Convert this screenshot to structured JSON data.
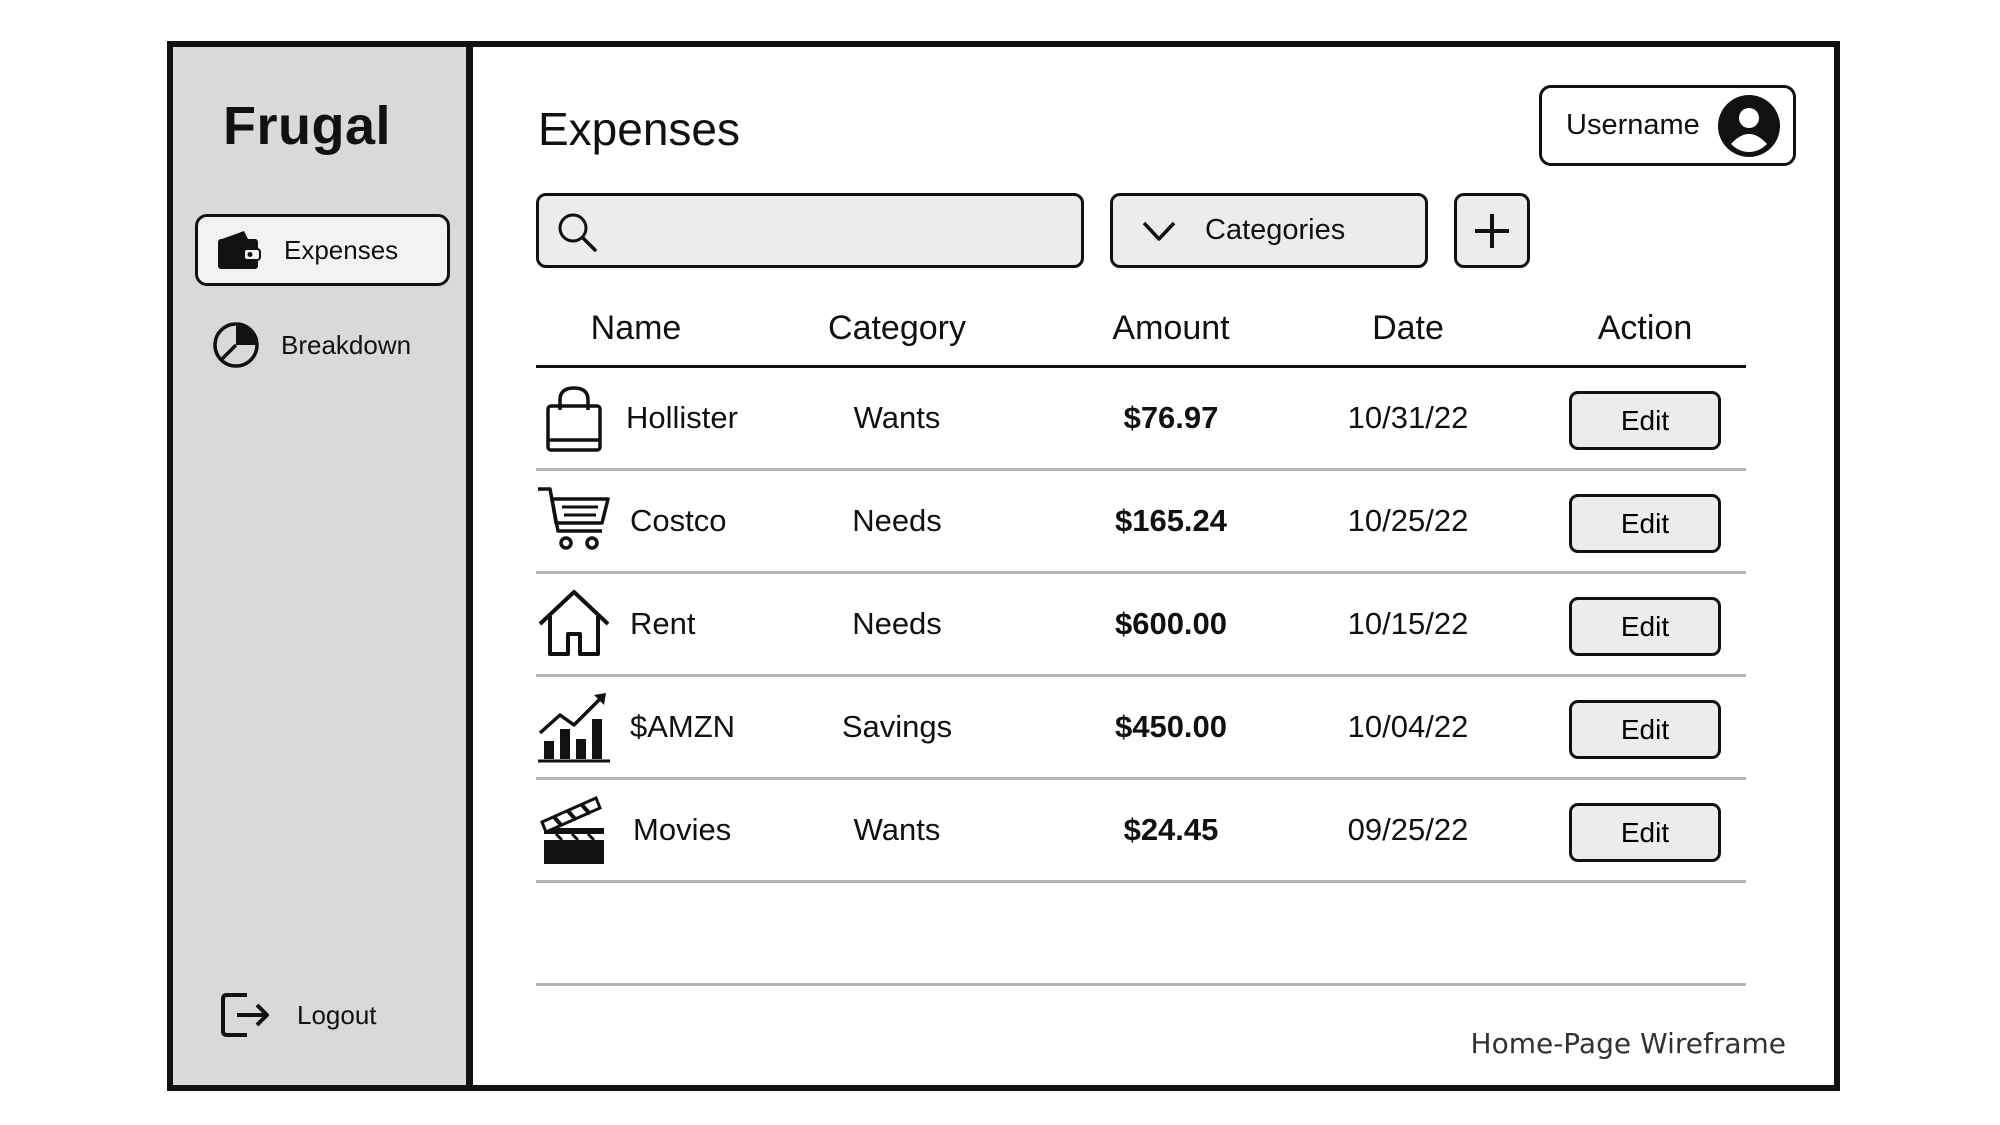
{
  "app": {
    "brand": "Frugal"
  },
  "sidebar": {
    "items": [
      {
        "label": "Expenses",
        "icon": "wallet-icon",
        "active": true
      },
      {
        "label": "Breakdown",
        "icon": "pie-chart-icon",
        "active": false
      }
    ],
    "logout_label": "Logout"
  },
  "header": {
    "title": "Expenses",
    "username": "Username"
  },
  "toolbar": {
    "search_value": "",
    "search_placeholder": "",
    "categories_label": "Categories"
  },
  "table": {
    "columns": [
      "Name",
      "Category",
      "Amount",
      "Date",
      "Action"
    ],
    "rows": [
      {
        "name": "Hollister",
        "category": "Wants",
        "amount": "$76.97",
        "date": "10/31/22",
        "action": "Edit",
        "icon": "shopping-bag-icon"
      },
      {
        "name": "Costco",
        "category": "Needs",
        "amount": "$165.24",
        "date": "10/25/22",
        "action": "Edit",
        "icon": "shopping-cart-icon"
      },
      {
        "name": "Rent",
        "category": "Needs",
        "amount": "$600.00",
        "date": "10/15/22",
        "action": "Edit",
        "icon": "house-icon"
      },
      {
        "name": "$AMZN",
        "category": "Savings",
        "amount": "$450.00",
        "date": "10/04/22",
        "action": "Edit",
        "icon": "stock-chart-icon"
      },
      {
        "name": "Movies",
        "category": "Wants",
        "amount": "$24.45",
        "date": "09/25/22",
        "action": "Edit",
        "icon": "clapperboard-icon"
      }
    ]
  },
  "footer": {
    "caption": "Home-Page Wireframe"
  }
}
